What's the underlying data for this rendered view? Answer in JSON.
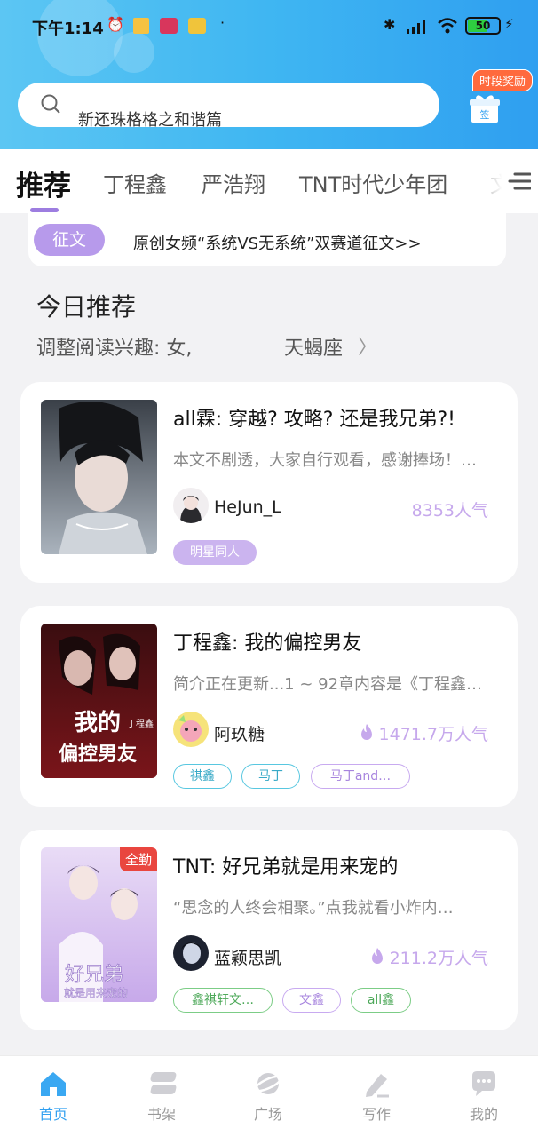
{
  "status_bar": {
    "time": "下午1:14",
    "battery": "50"
  },
  "search": {
    "placeholder": "新还珠格格之和谐篇"
  },
  "reward": {
    "badge": "时段奖励",
    "gift_label": "签"
  },
  "tabs": [
    {
      "label": "推荐",
      "active": true
    },
    {
      "label": "丁程鑫"
    },
    {
      "label": "严浩翔"
    },
    {
      "label": "TNT时代少年团"
    },
    {
      "label": "文"
    }
  ],
  "notice": {
    "tag": "征文",
    "text": "原创女频“系统VS无系统”双赛道征文>>"
  },
  "today": {
    "title": "今日推荐",
    "interest": "调整阅读兴趣: 女,",
    "zodiac": "天蝎座",
    "chevron": "〉"
  },
  "books": [
    {
      "title": "all霖: 穿越? 攻略? 还是我兄弟?!",
      "desc": "本文不剧透，大家自行观看，感谢捧场！…",
      "author": "HeJun_L",
      "popularity": "8353人气",
      "tags": [
        "明星同人"
      ]
    },
    {
      "title": "丁程鑫: 我的偏控男友",
      "desc": "简介正在更新...1 ~ 92章内容是《丁程鑫…",
      "author": "阿玖糖",
      "popularity": "1471.7万人气",
      "tags": [
        "祺鑫",
        "马丁",
        "马丁and…"
      ],
      "cover_text": [
        "我的",
        "偏控男友",
        "丁程鑫"
      ]
    },
    {
      "title": "TNT: 好兄弟就是用来宠的",
      "desc": "“思念的人终会相聚。”点我就看小炸内…",
      "author": "蓝颖思凯",
      "popularity": "211.2万人气",
      "tags": [
        "鑫祺轩文…",
        "文鑫",
        "all鑫"
      ],
      "badge": "全勤",
      "cover_text": [
        "好兄弟",
        "就是用来宠的"
      ]
    }
  ],
  "bottom_nav": [
    {
      "label": "首页",
      "icon": "home-icon",
      "active": true
    },
    {
      "label": "书架",
      "icon": "bookshelf-icon"
    },
    {
      "label": "广场",
      "icon": "planet-icon"
    },
    {
      "label": "写作",
      "icon": "pen-icon"
    },
    {
      "label": "我的",
      "icon": "chat-icon"
    }
  ],
  "colors": {
    "accent_blue": "#2f9ff0",
    "accent_purple": "#9d7de0",
    "popularity": "#c6a8ec"
  }
}
